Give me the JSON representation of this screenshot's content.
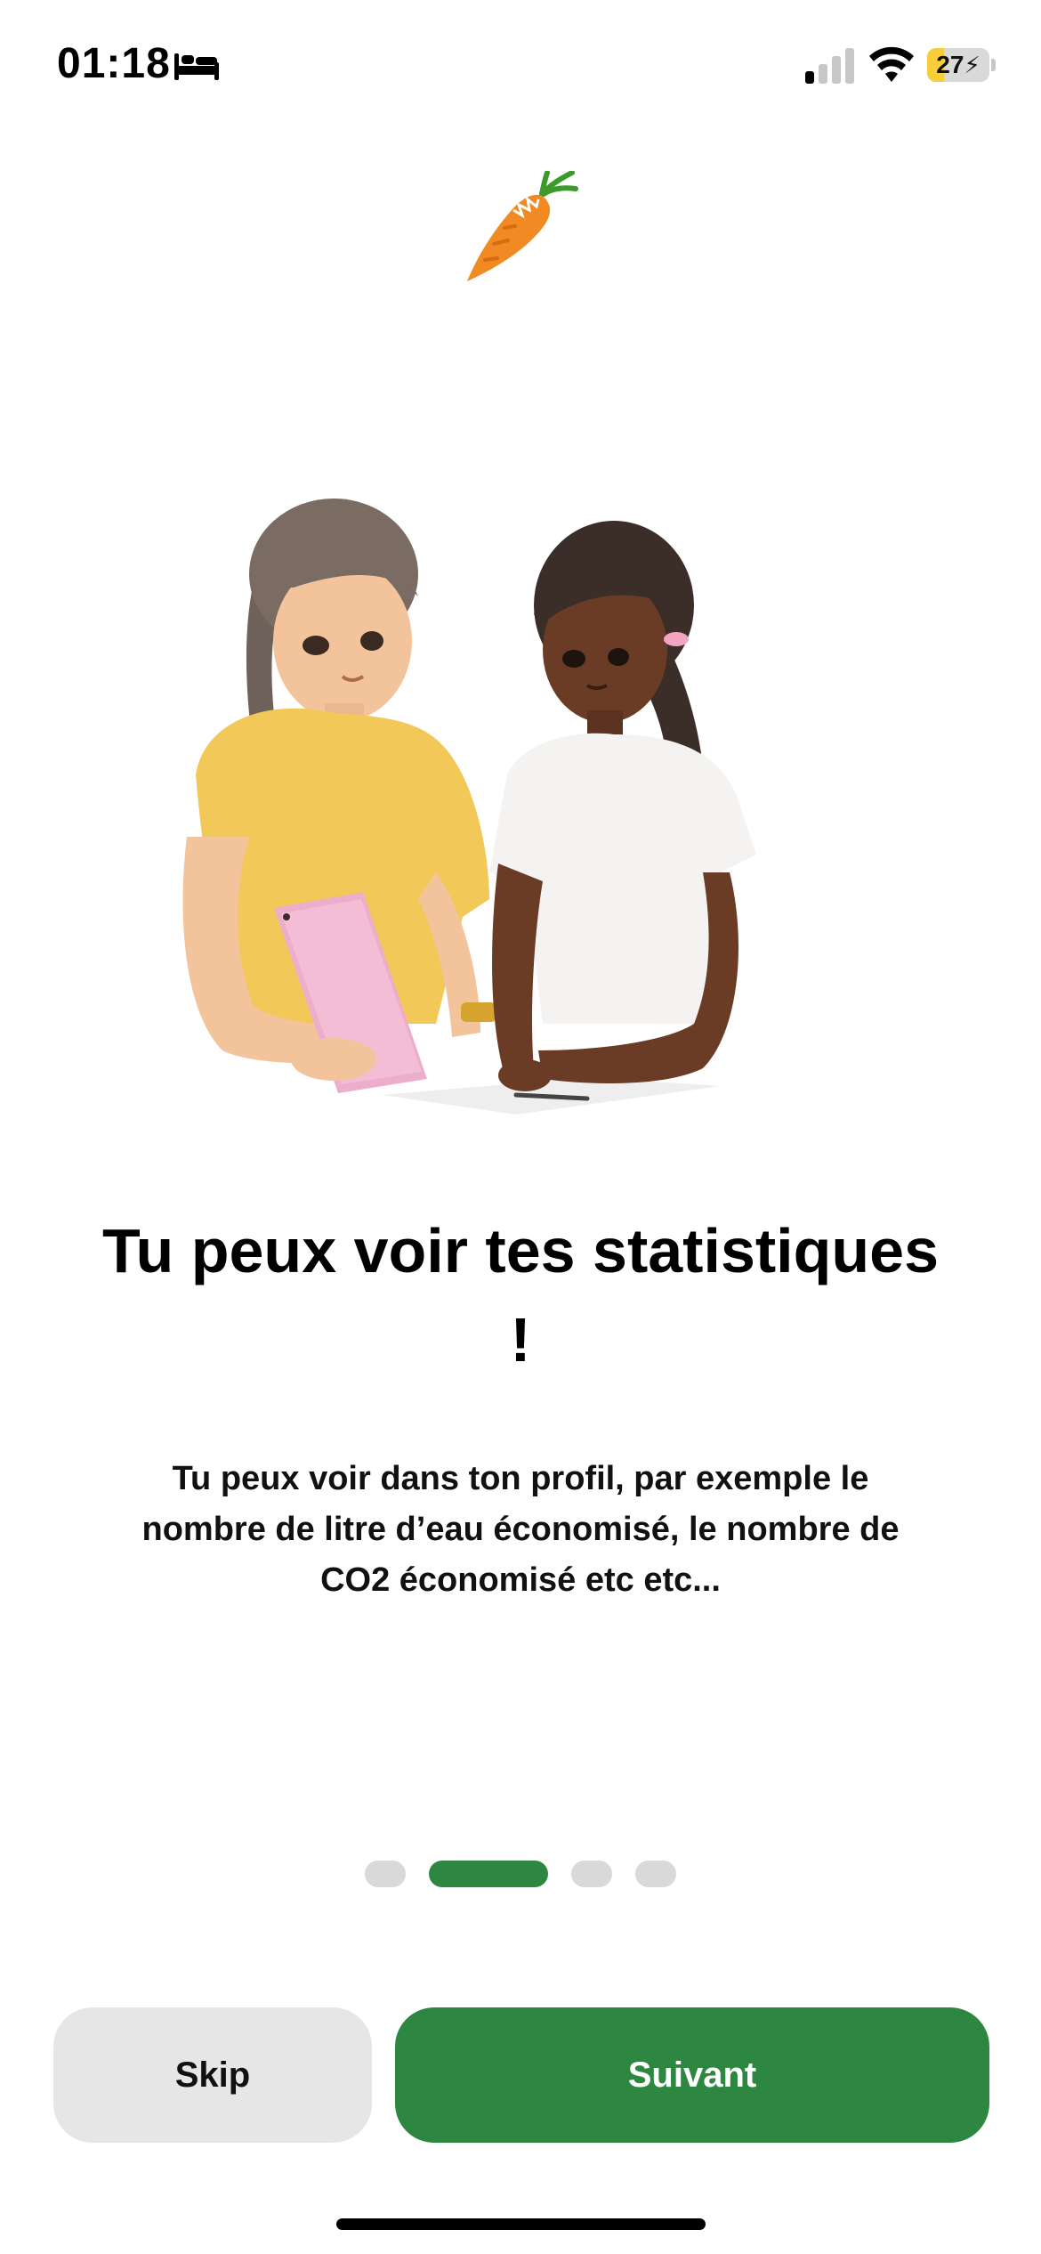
{
  "status_bar": {
    "time": "01:18",
    "battery_level": "27",
    "battery_charging": true,
    "battery_fraction": 0.27,
    "signal_bars_active": 1,
    "signal_bars_total": 4,
    "icons": [
      "bed-icon",
      "signal-icon",
      "wifi-icon",
      "battery-icon",
      "charging-bolt-icon"
    ]
  },
  "logo": {
    "icon": "carrot-icon"
  },
  "illustration": {
    "icon": "two-people-with-tablet-illustration"
  },
  "onboarding": {
    "title": "Tu peux voir tes statistiques !",
    "description": "Tu peux voir dans ton profil, par exemple le nombre de litre d’eau économisé, le nombre de CO2 économisé etc etc...",
    "current_page": 2,
    "total_pages": 4
  },
  "buttons": {
    "skip_label": "Skip",
    "next_label": "Suivant"
  },
  "colors": {
    "accent": "#2e8741",
    "secondary_button": "#e6e6e6",
    "inactive_dot": "#d9d9d9",
    "battery_fill": "#f7cd3a"
  }
}
